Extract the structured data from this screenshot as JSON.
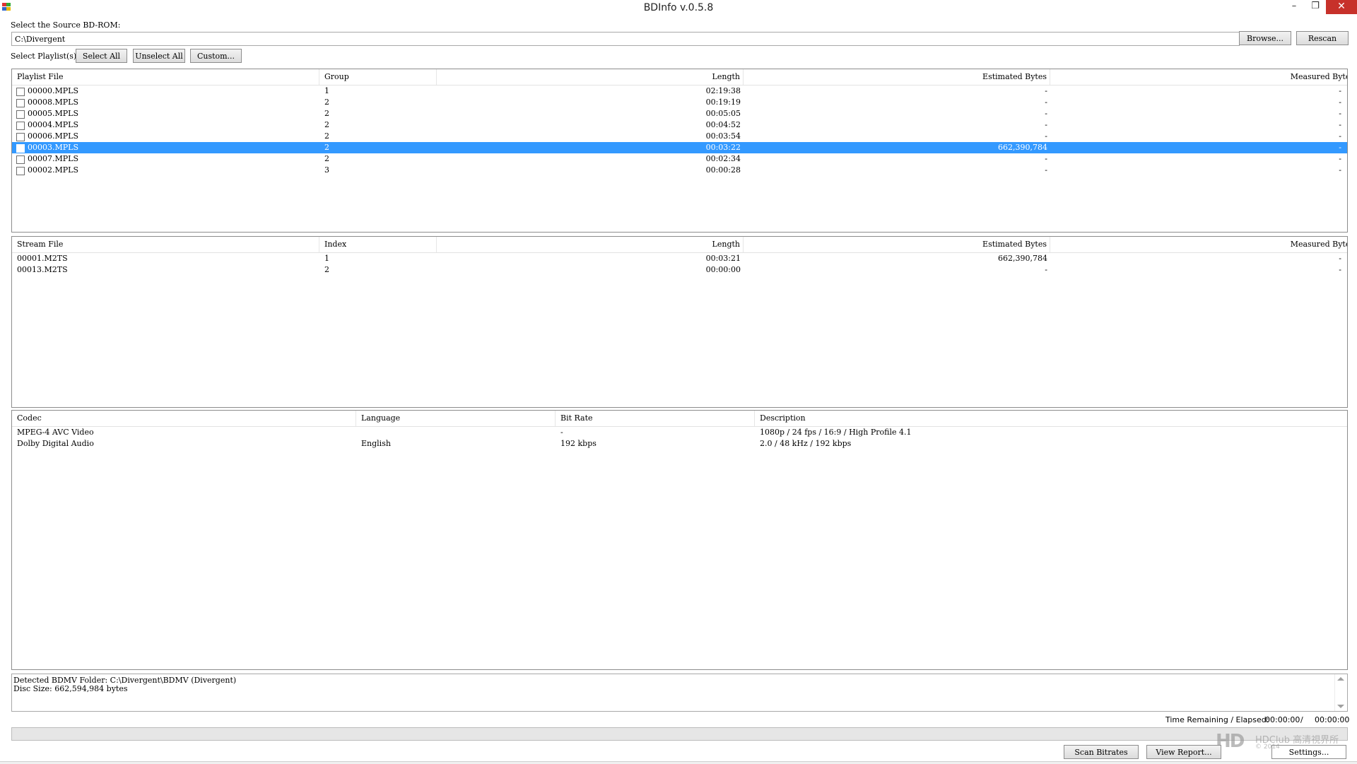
{
  "window": {
    "title": "BDInfo v.0.5.8",
    "minimize": "–",
    "maximize": "❐",
    "close": "✕"
  },
  "source": {
    "label": "Select the Source BD-ROM:",
    "path": "C:\\Divergent",
    "browse": "Browse...",
    "rescan": "Rescan"
  },
  "playlist_select": {
    "label": "Select Playlist(s):",
    "select_all": "Select All",
    "unselect_all": "Unselect All",
    "custom": "Custom..."
  },
  "playlists": {
    "headers": [
      "Playlist File",
      "Group",
      "Length",
      "Estimated Bytes",
      "Measured Bytes"
    ],
    "rows": [
      {
        "file": "00000.MPLS",
        "group": "1",
        "length": "02:19:38",
        "est": "-",
        "meas": "-",
        "checked": false,
        "selected": false
      },
      {
        "file": "00008.MPLS",
        "group": "2",
        "length": "00:19:19",
        "est": "-",
        "meas": "-",
        "checked": false,
        "selected": false
      },
      {
        "file": "00005.MPLS",
        "group": "2",
        "length": "00:05:05",
        "est": "-",
        "meas": "-",
        "checked": false,
        "selected": false
      },
      {
        "file": "00004.MPLS",
        "group": "2",
        "length": "00:04:52",
        "est": "-",
        "meas": "-",
        "checked": false,
        "selected": false
      },
      {
        "file": "00006.MPLS",
        "group": "2",
        "length": "00:03:54",
        "est": "-",
        "meas": "-",
        "checked": false,
        "selected": false
      },
      {
        "file": "00003.MPLS",
        "group": "2",
        "length": "00:03:22",
        "est": "662,390,784",
        "meas": "-",
        "checked": false,
        "selected": true
      },
      {
        "file": "00007.MPLS",
        "group": "2",
        "length": "00:02:34",
        "est": "-",
        "meas": "-",
        "checked": false,
        "selected": false
      },
      {
        "file": "00002.MPLS",
        "group": "3",
        "length": "00:00:28",
        "est": "-",
        "meas": "-",
        "checked": false,
        "selected": false
      }
    ]
  },
  "streams": {
    "headers": [
      "Stream File",
      "Index",
      "Length",
      "Estimated Bytes",
      "Measured Bytes"
    ],
    "rows": [
      {
        "file": "00001.M2TS",
        "index": "1",
        "length": "00:03:21",
        "est": "662,390,784",
        "meas": "-"
      },
      {
        "file": "00013.M2TS",
        "index": "2",
        "length": "00:00:00",
        "est": "-",
        "meas": "-"
      }
    ]
  },
  "codecs": {
    "headers": [
      "Codec",
      "Language",
      "Bit Rate",
      "Description"
    ],
    "rows": [
      {
        "codec": "MPEG-4 AVC Video",
        "language": "",
        "bitrate": "-",
        "description": "1080p / 24 fps / 16:9 / High Profile 4.1"
      },
      {
        "codec": "Dolby Digital Audio",
        "language": "English",
        "bitrate": "192 kbps",
        "description": "2.0 / 48 kHz / 192 kbps"
      }
    ]
  },
  "status": {
    "lines": [
      "Detected BDMV Folder: C:\\Divergent\\BDMV (Divergent)",
      "Disc Size: 662,594,984 bytes"
    ]
  },
  "time": {
    "label": "Time Remaining / Elapsed:",
    "remaining": "00:00:00",
    "separator": "/",
    "elapsed": "00:00:00"
  },
  "progress": {
    "value": 0
  },
  "actions": {
    "scan": "Scan Bitrates",
    "report": "View Report...",
    "settings": "Settings..."
  },
  "watermark": {
    "logo": "HD",
    "brand": "HDClub 高清視界所",
    "copy": "© 2014"
  },
  "colors": {
    "selection": "#3399ff",
    "close_button": "#c7312a"
  }
}
